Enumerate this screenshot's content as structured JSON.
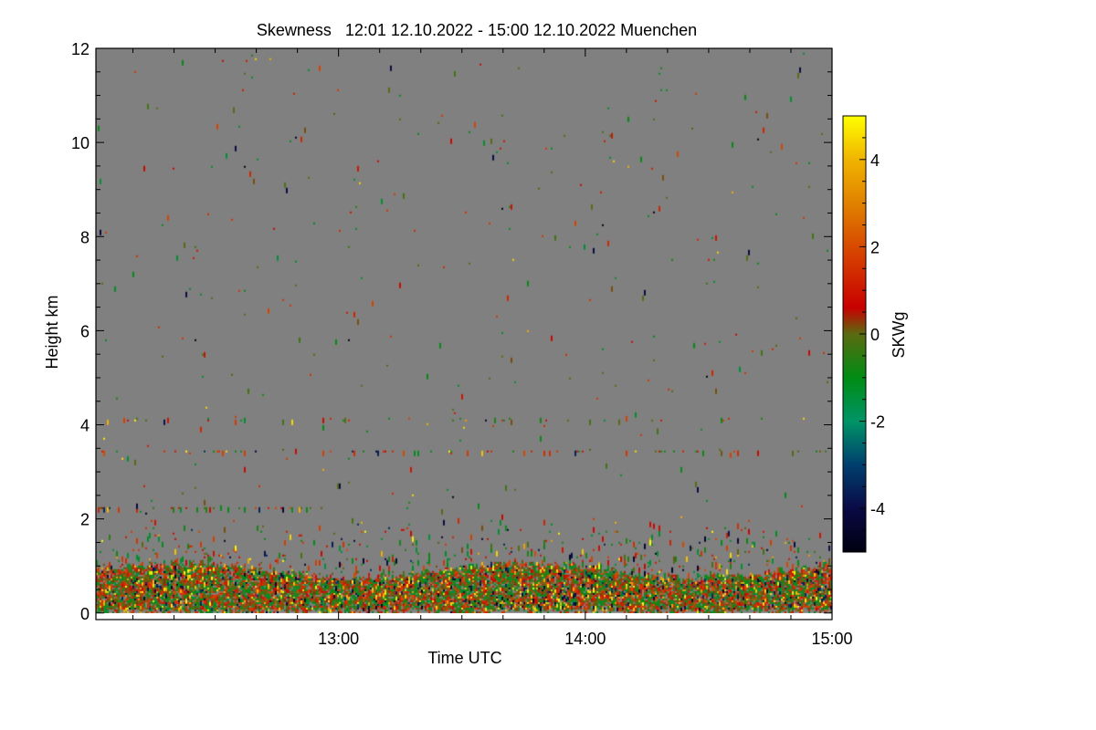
{
  "chart_data": {
    "type": "heatmap",
    "title": "Skewness   12:01 12.10.2022 - 15:00 12.10.2022 Muenchen",
    "xlabel": "Time UTC",
    "ylabel": "Height km",
    "xlim": [
      "12:01",
      "15:00"
    ],
    "ylim": [
      -0.14,
      12
    ],
    "x_ticks": [
      "13:00",
      "14:00",
      "15:00"
    ],
    "y_ticks": [
      "0",
      "2",
      "4",
      "6",
      "8",
      "10",
      "12"
    ],
    "background_color": "#808080",
    "colorbar": {
      "label": "SKWg",
      "range": [
        -5,
        5
      ],
      "ticks": [
        "-4",
        "-2",
        "0",
        "2",
        "4"
      ],
      "colormap": [
        {
          "v": -5,
          "color": "#000010"
        },
        {
          "v": -4,
          "color": "#0a0a45"
        },
        {
          "v": -3,
          "color": "#003f6e"
        },
        {
          "v": -2,
          "color": "#009466"
        },
        {
          "v": -1,
          "color": "#008c14"
        },
        {
          "v": 0,
          "color": "#5a6a10"
        },
        {
          "v": 0.6,
          "color": "#c80000"
        },
        {
          "v": 2,
          "color": "#d84a00"
        },
        {
          "v": 3,
          "color": "#e08200"
        },
        {
          "v": 4,
          "color": "#f0b400"
        },
        {
          "v": 5,
          "color": "#ffff00"
        }
      ]
    }
  }
}
